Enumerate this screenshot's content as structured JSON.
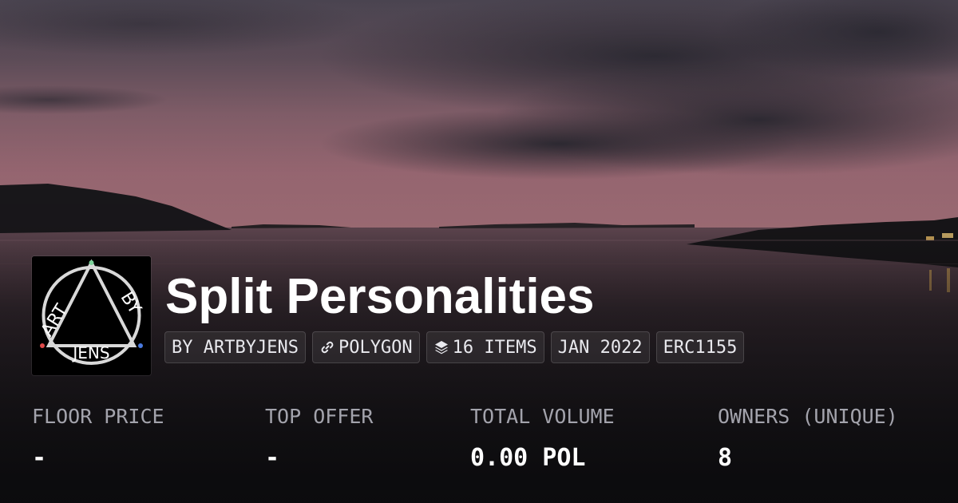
{
  "collection": {
    "title": "Split Personalities",
    "avatar": {
      "top_left_text": "ART",
      "top_right_text": "BY",
      "bottom_text": "JENS"
    },
    "badges": [
      {
        "text": "BY ARTBYJENS",
        "icon": null
      },
      {
        "text": "POLYGON",
        "icon": "chain-link-icon"
      },
      {
        "text": "16 ITEMS",
        "icon": "layers-icon"
      },
      {
        "text": "JAN 2022",
        "icon": null
      },
      {
        "text": "ERC1155",
        "icon": null
      }
    ]
  },
  "stats": [
    {
      "label": "FLOOR PRICE",
      "value": "-"
    },
    {
      "label": "TOP OFFER",
      "value": "-"
    },
    {
      "label": "TOTAL VOLUME",
      "value": "0.00 POL"
    },
    {
      "label": "OWNERS (UNIQUE)",
      "value": "8"
    }
  ],
  "colors": {
    "overlay_dark": "#0b0b0d",
    "stat_label": "#a3a3ac",
    "text": "#ffffff",
    "sky_pink": "#b27a86",
    "badge_border": "#3a3a40"
  }
}
